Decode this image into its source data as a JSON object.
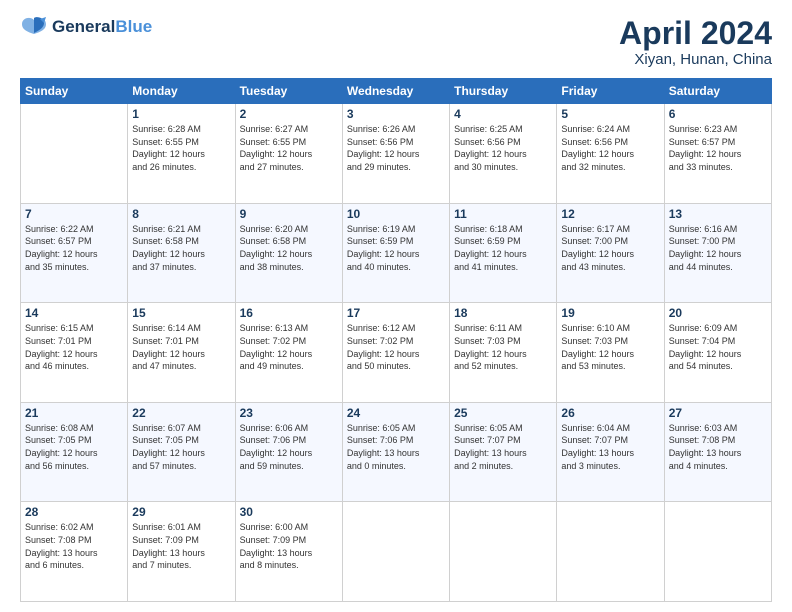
{
  "header": {
    "logo_line1": "General",
    "logo_line2": "Blue",
    "main_title": "April 2024",
    "sub_title": "Xiyan, Hunan, China"
  },
  "calendar": {
    "days_of_week": [
      "Sunday",
      "Monday",
      "Tuesday",
      "Wednesday",
      "Thursday",
      "Friday",
      "Saturday"
    ],
    "weeks": [
      [
        {
          "day": "",
          "info": ""
        },
        {
          "day": "1",
          "info": "Sunrise: 6:28 AM\nSunset: 6:55 PM\nDaylight: 12 hours\nand 26 minutes."
        },
        {
          "day": "2",
          "info": "Sunrise: 6:27 AM\nSunset: 6:55 PM\nDaylight: 12 hours\nand 27 minutes."
        },
        {
          "day": "3",
          "info": "Sunrise: 6:26 AM\nSunset: 6:56 PM\nDaylight: 12 hours\nand 29 minutes."
        },
        {
          "day": "4",
          "info": "Sunrise: 6:25 AM\nSunset: 6:56 PM\nDaylight: 12 hours\nand 30 minutes."
        },
        {
          "day": "5",
          "info": "Sunrise: 6:24 AM\nSunset: 6:56 PM\nDaylight: 12 hours\nand 32 minutes."
        },
        {
          "day": "6",
          "info": "Sunrise: 6:23 AM\nSunset: 6:57 PM\nDaylight: 12 hours\nand 33 minutes."
        }
      ],
      [
        {
          "day": "7",
          "info": "Sunrise: 6:22 AM\nSunset: 6:57 PM\nDaylight: 12 hours\nand 35 minutes."
        },
        {
          "day": "8",
          "info": "Sunrise: 6:21 AM\nSunset: 6:58 PM\nDaylight: 12 hours\nand 37 minutes."
        },
        {
          "day": "9",
          "info": "Sunrise: 6:20 AM\nSunset: 6:58 PM\nDaylight: 12 hours\nand 38 minutes."
        },
        {
          "day": "10",
          "info": "Sunrise: 6:19 AM\nSunset: 6:59 PM\nDaylight: 12 hours\nand 40 minutes."
        },
        {
          "day": "11",
          "info": "Sunrise: 6:18 AM\nSunset: 6:59 PM\nDaylight: 12 hours\nand 41 minutes."
        },
        {
          "day": "12",
          "info": "Sunrise: 6:17 AM\nSunset: 7:00 PM\nDaylight: 12 hours\nand 43 minutes."
        },
        {
          "day": "13",
          "info": "Sunrise: 6:16 AM\nSunset: 7:00 PM\nDaylight: 12 hours\nand 44 minutes."
        }
      ],
      [
        {
          "day": "14",
          "info": "Sunrise: 6:15 AM\nSunset: 7:01 PM\nDaylight: 12 hours\nand 46 minutes."
        },
        {
          "day": "15",
          "info": "Sunrise: 6:14 AM\nSunset: 7:01 PM\nDaylight: 12 hours\nand 47 minutes."
        },
        {
          "day": "16",
          "info": "Sunrise: 6:13 AM\nSunset: 7:02 PM\nDaylight: 12 hours\nand 49 minutes."
        },
        {
          "day": "17",
          "info": "Sunrise: 6:12 AM\nSunset: 7:02 PM\nDaylight: 12 hours\nand 50 minutes."
        },
        {
          "day": "18",
          "info": "Sunrise: 6:11 AM\nSunset: 7:03 PM\nDaylight: 12 hours\nand 52 minutes."
        },
        {
          "day": "19",
          "info": "Sunrise: 6:10 AM\nSunset: 7:03 PM\nDaylight: 12 hours\nand 53 minutes."
        },
        {
          "day": "20",
          "info": "Sunrise: 6:09 AM\nSunset: 7:04 PM\nDaylight: 12 hours\nand 54 minutes."
        }
      ],
      [
        {
          "day": "21",
          "info": "Sunrise: 6:08 AM\nSunset: 7:05 PM\nDaylight: 12 hours\nand 56 minutes."
        },
        {
          "day": "22",
          "info": "Sunrise: 6:07 AM\nSunset: 7:05 PM\nDaylight: 12 hours\nand 57 minutes."
        },
        {
          "day": "23",
          "info": "Sunrise: 6:06 AM\nSunset: 7:06 PM\nDaylight: 12 hours\nand 59 minutes."
        },
        {
          "day": "24",
          "info": "Sunrise: 6:05 AM\nSunset: 7:06 PM\nDaylight: 13 hours\nand 0 minutes."
        },
        {
          "day": "25",
          "info": "Sunrise: 6:05 AM\nSunset: 7:07 PM\nDaylight: 13 hours\nand 2 minutes."
        },
        {
          "day": "26",
          "info": "Sunrise: 6:04 AM\nSunset: 7:07 PM\nDaylight: 13 hours\nand 3 minutes."
        },
        {
          "day": "27",
          "info": "Sunrise: 6:03 AM\nSunset: 7:08 PM\nDaylight: 13 hours\nand 4 minutes."
        }
      ],
      [
        {
          "day": "28",
          "info": "Sunrise: 6:02 AM\nSunset: 7:08 PM\nDaylight: 13 hours\nand 6 minutes."
        },
        {
          "day": "29",
          "info": "Sunrise: 6:01 AM\nSunset: 7:09 PM\nDaylight: 13 hours\nand 7 minutes."
        },
        {
          "day": "30",
          "info": "Sunrise: 6:00 AM\nSunset: 7:09 PM\nDaylight: 13 hours\nand 8 minutes."
        },
        {
          "day": "",
          "info": ""
        },
        {
          "day": "",
          "info": ""
        },
        {
          "day": "",
          "info": ""
        },
        {
          "day": "",
          "info": ""
        }
      ]
    ]
  }
}
